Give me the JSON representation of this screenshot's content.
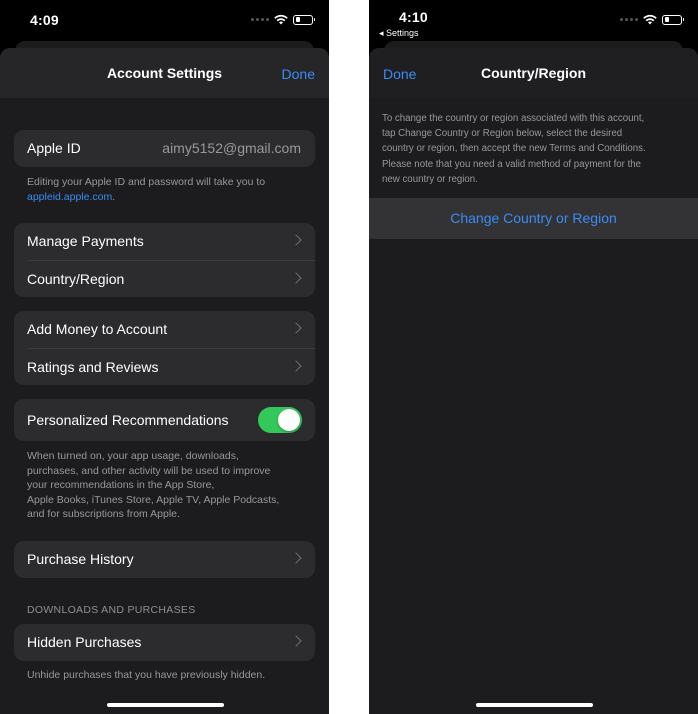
{
  "left": {
    "status": {
      "time": "4:09"
    },
    "nav": {
      "title": "Account Settings",
      "done": "Done"
    },
    "apple_id": {
      "label": "Apple ID",
      "value": "aimy5152@gmail.com"
    },
    "apple_id_note": {
      "text": "Editing your Apple ID and password will take you to",
      "link": "appleid.apple.com",
      "suffix": "."
    },
    "group1": [
      {
        "label": "Manage Payments"
      },
      {
        "label": "Country/Region"
      }
    ],
    "group2": [
      {
        "label": "Add Money to Account"
      },
      {
        "label": "Ratings and Reviews"
      }
    ],
    "personalized": {
      "label": "Personalized Recommendations",
      "enabled": true,
      "color": "#34c759"
    },
    "personalized_note": {
      "line1": "When turned on, your app usage, downloads,",
      "line2": "purchases, and other activity will be used to improve",
      "line3": "your recommendations in the App Store,",
      "line4": "Apple Books, iTunes Store, Apple TV, Apple Podcasts,",
      "line5": "and for subscriptions from Apple."
    },
    "purchase_history": {
      "label": "Purchase History"
    },
    "downloads_header": "DOWNLOADS AND PURCHASES",
    "hidden_purchases": {
      "label": "Hidden Purchases"
    },
    "hidden_note": "Unhide purchases that you have previously hidden."
  },
  "right": {
    "status": {
      "time": "4:10",
      "back": "◂ Settings"
    },
    "nav": {
      "title": "Country/Region",
      "done": "Done"
    },
    "description": {
      "line1": "To change the country or region associated with this account,",
      "line2": "tap Change Country or Region below, select the desired",
      "line3": "country or region, then accept the new Terms and Conditions.",
      "line4": "Please note that you need a valid method of payment for the",
      "line5": "new country or region."
    },
    "change_button": "Change Country or Region"
  },
  "colors": {
    "accent": "#3a8cf5",
    "toggle_on": "#34c759",
    "background": "#1c1c1e"
  }
}
